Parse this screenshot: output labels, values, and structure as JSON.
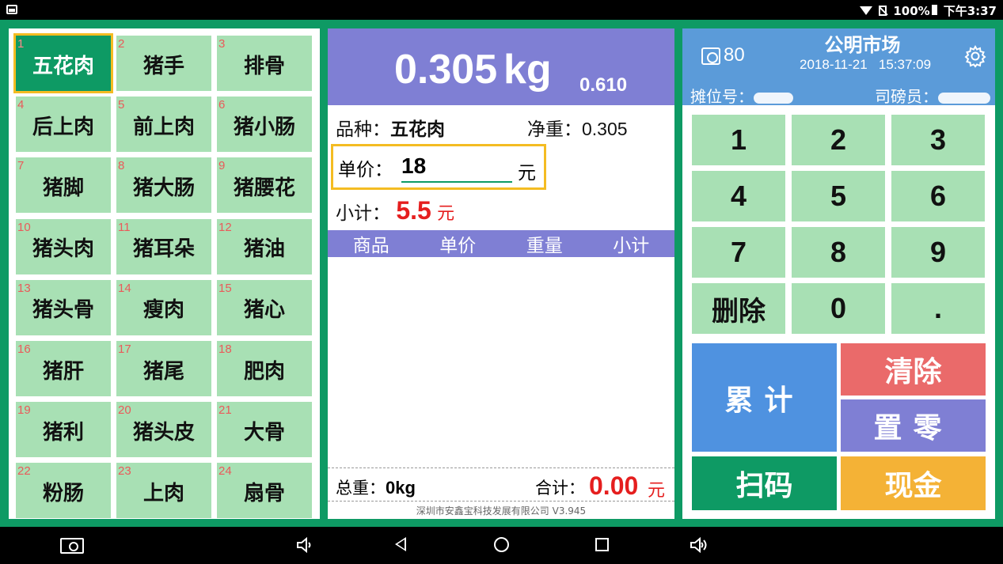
{
  "status_bar": {
    "battery": "100%",
    "time": "下午3:37"
  },
  "products": [
    {
      "num": "1",
      "name": "五花肉",
      "selected": true
    },
    {
      "num": "2",
      "name": "猪手"
    },
    {
      "num": "3",
      "name": "排骨"
    },
    {
      "num": "4",
      "name": "后上肉"
    },
    {
      "num": "5",
      "name": "前上肉"
    },
    {
      "num": "6",
      "name": "猪小肠"
    },
    {
      "num": "7",
      "name": "猪脚"
    },
    {
      "num": "8",
      "name": "猪大肠"
    },
    {
      "num": "9",
      "name": "猪腰花"
    },
    {
      "num": "10",
      "name": "猪头肉"
    },
    {
      "num": "11",
      "name": "猪耳朵"
    },
    {
      "num": "12",
      "name": "猪油"
    },
    {
      "num": "13",
      "name": "猪头骨"
    },
    {
      "num": "14",
      "name": "瘦肉"
    },
    {
      "num": "15",
      "name": "猪心"
    },
    {
      "num": "16",
      "name": "猪肝"
    },
    {
      "num": "17",
      "name": "猪尾"
    },
    {
      "num": "18",
      "name": "肥肉"
    },
    {
      "num": "19",
      "name": "猪利"
    },
    {
      "num": "20",
      "name": "猪头皮"
    },
    {
      "num": "21",
      "name": "大骨"
    },
    {
      "num": "22",
      "name": "粉肠"
    },
    {
      "num": "23",
      "name": "上肉"
    },
    {
      "num": "24",
      "name": "扇骨"
    }
  ],
  "weighing": {
    "weight": "0.305",
    "unit": "kg",
    "secondary": "0.610",
    "variety_label": "品种：",
    "variety_value": "五花肉",
    "net_label": "净重：",
    "net_value": "0.305",
    "price_label": "单价：",
    "price_value": "18",
    "price_unit": "元",
    "subtotal_label": "小计：",
    "subtotal_value": "5.5",
    "subtotal_unit": "元"
  },
  "table": {
    "headers": [
      "商品",
      "单价",
      "重量",
      "小计"
    ]
  },
  "totals": {
    "weight_label": "总重：",
    "weight_value": "0kg",
    "sum_label": "合计：",
    "sum_value": "0.00",
    "sum_unit": "元"
  },
  "footer": {
    "company": "深圳市安鑫宝科技发展有限公司   V3.945"
  },
  "header": {
    "scale_number": "80",
    "market": "公明市场",
    "date": "2018-11-21",
    "time": "15:37:09",
    "stall_label": "摊位号：",
    "weigher_label": "司磅员："
  },
  "keypad": [
    "1",
    "2",
    "3",
    "4",
    "5",
    "6",
    "7",
    "8",
    "9",
    "删除",
    "0",
    "."
  ],
  "actions": {
    "accumulate": "累计",
    "clear": "清除",
    "zero": "置零",
    "scan": "扫码",
    "cash": "现金"
  },
  "colors": {
    "green": "#0e9a64",
    "light_green": "#a8e0b4",
    "purple": "#7f7fd4",
    "blue": "#5b9bd9",
    "red": "#e51e1e",
    "yellow": "#f4bc22"
  }
}
